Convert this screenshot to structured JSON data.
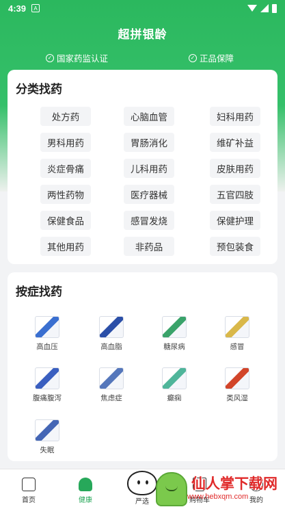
{
  "status_bar": {
    "time": "4:39",
    "notif_letter": "A"
  },
  "header": {
    "title": "超拼银龄",
    "badges": [
      "国家药监认证",
      "正品保障"
    ]
  },
  "category_section": {
    "title": "分类找药",
    "items": [
      "处方药",
      "心脑血管",
      "妇科用药",
      "男科用药",
      "胃肠消化",
      "维矿补益",
      "炎症骨痛",
      "儿科用药",
      "皮肤用药",
      "两性药物",
      "医疗器械",
      "五官四肢",
      "保健食品",
      "感冒发烧",
      "保健护理",
      "其他用药",
      "非药品",
      "预包装食"
    ]
  },
  "symptom_section": {
    "title": "按症找药",
    "items": [
      {
        "label": "高血压",
        "color": "#3a6fd0"
      },
      {
        "label": "高血脂",
        "color": "#2b4fa8"
      },
      {
        "label": "糖尿病",
        "color": "#3aa36a"
      },
      {
        "label": "感冒",
        "color": "#d9b84a"
      },
      {
        "label": "腹痛腹泻",
        "color": "#3a5fc0"
      },
      {
        "label": "焦虑症",
        "color": "#5577bb"
      },
      {
        "label": "癫痫",
        "color": "#4fb59a"
      },
      {
        "label": "类风湿",
        "color": "#d2452a"
      },
      {
        "label": "失眠",
        "color": "#4466b5"
      }
    ]
  },
  "bottom_nav": {
    "items": [
      "首页",
      "健康",
      "严选",
      "购物车",
      "我的"
    ],
    "active": "健康"
  },
  "watermark": {
    "text": "仙人掌下载网",
    "url": "www.hebxqm.com"
  },
  "colors": {
    "brand_green": "#2bb85e",
    "active_green": "#27a85a"
  }
}
